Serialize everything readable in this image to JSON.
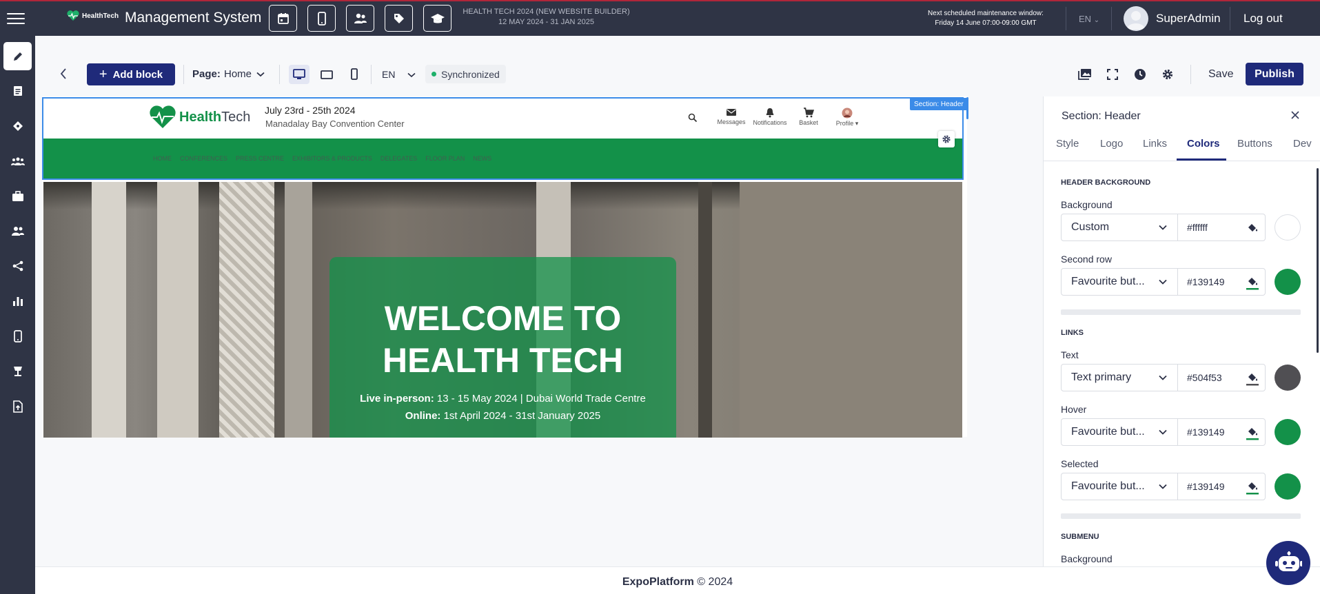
{
  "topbar": {
    "logo_text": "HealthTech",
    "title": "Management System",
    "event_name": "HEALTH TECH 2024 (NEW WEBSITE BUILDER)",
    "event_dates": "12 MAY 2024 - 31 JAN 2025",
    "maintenance_label": "Next scheduled maintenance window:",
    "maintenance_date": "Friday 14 June 07:00-09:00 GMT",
    "language": "EN",
    "user_name": "SuperAdmin",
    "logout_label": "Log out",
    "icons": [
      "calendar-icon",
      "mobile-icon",
      "people-icon",
      "tag-icon",
      "graduation-cap-icon"
    ]
  },
  "toolbar": {
    "add_block_label": "Add block",
    "page_label": "Page:",
    "page_value": "Home",
    "language": "EN",
    "sync_status": "Synchronized",
    "save_label": "Save",
    "publish_label": "Publish"
  },
  "preview": {
    "section_tag": "Section: Header",
    "brand_health": "Health",
    "brand_tech": "Tech",
    "event_date": "July 23rd - 25th 2024",
    "venue": "Manadalay Bay Convention Center",
    "icons": [
      {
        "name": "messages",
        "label": "Messages"
      },
      {
        "name": "notifications",
        "label": "Notifications"
      },
      {
        "name": "basket",
        "label": "Basket"
      },
      {
        "name": "profile",
        "label": "Profile ▾"
      }
    ],
    "nav": [
      "HOME",
      "CONFERENCES",
      "PRESS CENTRE",
      "EXHIBITORS & PRODUCTS",
      "DELEGATES",
      "FLOOR PLAN",
      "NEWS"
    ],
    "hero_title_1": "WELCOME TO",
    "hero_title_2": "HEALTH TECH",
    "hero_line1_bold": "Live in-person:",
    "hero_line1": " 13  - 15 May 2024 | Dubai World Trade Centre",
    "hero_line2_bold": "Online:",
    "hero_line2": " 1st April 2024 - 31st January 2025"
  },
  "panel": {
    "title": "Section: Header",
    "tabs": [
      "Style",
      "Logo",
      "Links",
      "Colors",
      "Buttons",
      "Dev"
    ],
    "active_tab": "Colors",
    "header_background_heading": "HEADER BACKGROUND",
    "background_label": "Background",
    "background_select": "Custom",
    "background_hex": "#ffffff",
    "second_row_label": "Second row",
    "second_row_select": "Favourite but...",
    "second_row_hex": "#139149",
    "links_heading": "LINKS",
    "text_label": "Text",
    "text_select": "Text primary",
    "text_hex": "#504f53",
    "hover_label": "Hover",
    "hover_select": "Favourite but...",
    "hover_hex": "#139149",
    "selected_label": "Selected",
    "selected_select": "Favourite but...",
    "selected_hex": "#139149",
    "submenu_heading": "SUBMENU",
    "submenu_background_label": "Background"
  },
  "footer": {
    "brand": "ExpoPlatform",
    "copyright": " © 2024"
  },
  "colors": {
    "accent": "#1f2a7a",
    "brand_green": "#139149",
    "text_primary": "#504f53",
    "topbar": "#2f3445"
  }
}
